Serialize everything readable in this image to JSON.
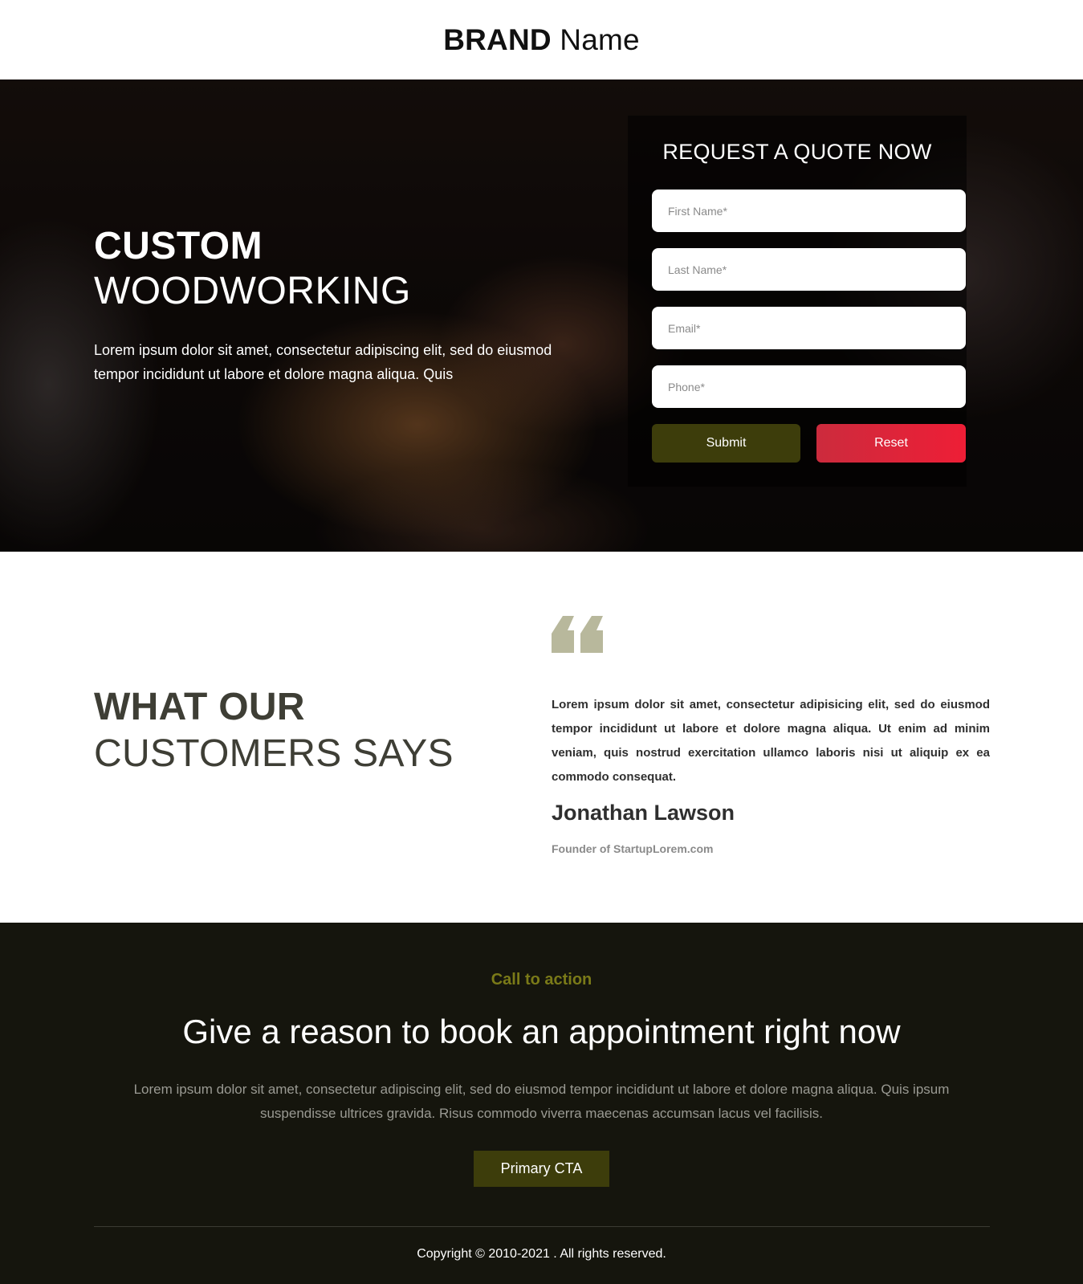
{
  "header": {
    "brand_bold": "BRAND",
    "brand_light": "Name"
  },
  "hero": {
    "title_line1": "CUSTOM",
    "title_line2": "WOODWORKING",
    "text": "Lorem ipsum dolor sit amet, consectetur adipiscing elit, sed do eiusmod tempor incididunt ut labore et dolore magna aliqua. Quis"
  },
  "quote_form": {
    "title": "REQUEST A QUOTE NOW",
    "first_name_placeholder": "First Name*",
    "last_name_placeholder": "Last Name*",
    "email_placeholder": "Email*",
    "phone_placeholder": "Phone*",
    "submit_label": "Submit",
    "reset_label": "Reset"
  },
  "testimonial": {
    "heading_line1": "WHAT OUR",
    "heading_line2": "CUSTOMERS SAYS",
    "quote_icon": "quote-icon",
    "body": "Lorem ipsum dolor sit amet, consectetur adipisicing elit, sed do eiusmod tempor incididunt ut labore et dolore magna aliqua. Ut enim ad minim veniam, quis nostrud exercitation ullamco laboris nisi ut aliquip ex ea commodo consequat.",
    "name": "Jonathan Lawson",
    "role": "Founder of StartupLorem.com"
  },
  "cta": {
    "eyebrow": "Call to action",
    "title": "Give a reason to book an appointment right now",
    "text": "Lorem ipsum dolor sit amet, consectetur adipiscing elit, sed do eiusmod tempor incididunt ut labore et dolore magna aliqua. Quis ipsum suspendisse ultrices gravida. Risus commodo viverra maecenas accumsan lacus vel facilisis.",
    "button_label": "Primary CTA"
  },
  "footer": {
    "copyright": "Copyright © 2010-2021 . All rights reserved."
  },
  "colors": {
    "accent_olive": "#3d3d0b",
    "eyebrow_olive": "#7a7a18",
    "reset_red": "#ee1e36",
    "dark_bg": "#15150d",
    "quote_icon": "#b8b89c"
  }
}
